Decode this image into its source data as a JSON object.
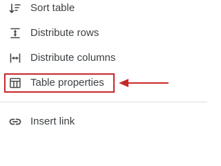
{
  "menu": {
    "items": [
      {
        "label": "Sort table",
        "icon": "sort-icon"
      },
      {
        "label": "Distribute rows",
        "icon": "distribute-rows-icon"
      },
      {
        "label": "Distribute columns",
        "icon": "distribute-columns-icon"
      },
      {
        "label": "Table properties",
        "icon": "table-icon"
      },
      {
        "label": "Insert link",
        "icon": "link-icon"
      }
    ]
  },
  "annotation": {
    "highlight_color": "#c62828",
    "arrow_icon": "arrow-left-icon"
  },
  "colors": {
    "text": "#3c4043",
    "icon": "#444746",
    "divider": "#dadce0"
  }
}
